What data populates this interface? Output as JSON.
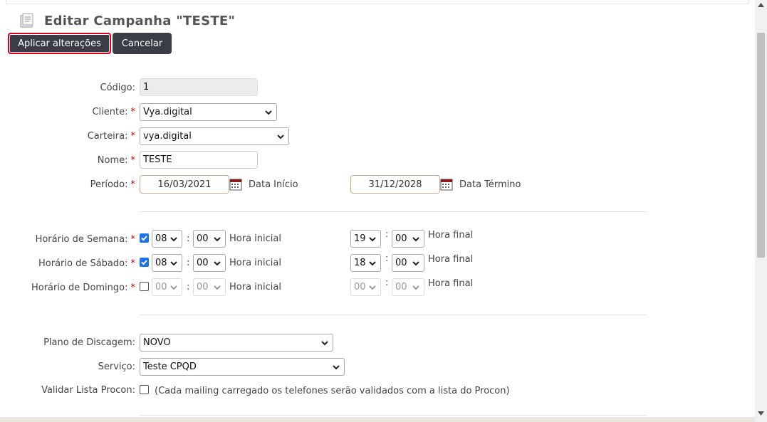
{
  "page": {
    "title": "Editar Campanha \"TESTE\""
  },
  "toolbar": {
    "apply_label": "Aplicar alterações",
    "cancel_label": "Cancelar"
  },
  "form": {
    "codigo": {
      "label": "Código:",
      "value": "1"
    },
    "cliente": {
      "label": "Cliente:",
      "value": "Vya.digital"
    },
    "carteira": {
      "label": "Carteira:",
      "value": "vya.digital"
    },
    "nome": {
      "label": "Nome:",
      "value": "TESTE"
    },
    "periodo": {
      "label": "Período:",
      "start": "16/03/2021",
      "start_label": "Data Início",
      "end": "31/12/2028",
      "end_label": "Data Término"
    },
    "semana": {
      "label": "Horário de Semana:",
      "checked": true,
      "start_h": "08",
      "start_m": "00",
      "start_label": "Hora inicial",
      "end_h": "19",
      "end_m": "00",
      "end_label": "Hora final"
    },
    "sabado": {
      "label": "Horário de Sábado:",
      "checked": true,
      "start_h": "08",
      "start_m": "00",
      "start_label": "Hora inicial",
      "end_h": "18",
      "end_m": "00",
      "end_label": "Hora final"
    },
    "domingo": {
      "label": "Horário de Domingo:",
      "checked": false,
      "start_h": "00",
      "start_m": "00",
      "start_label": "Hora inicial",
      "end_h": "00",
      "end_m": "00",
      "end_label": "Hora final"
    },
    "plano": {
      "label": "Plano de Discagem:",
      "value": "NOVO"
    },
    "servico": {
      "label": "Serviço:",
      "value": "Teste CPQD"
    },
    "procon": {
      "label": "Validar Lista Procon:",
      "checked": false,
      "note": "(Cada mailing carregado os telefones serão validados com a lista do Procon)"
    }
  },
  "colors": {
    "button_bg": "#3a3d45",
    "highlight_border": "#d9001b",
    "required": "#cc0000",
    "checkbox": "#1a73e8"
  }
}
